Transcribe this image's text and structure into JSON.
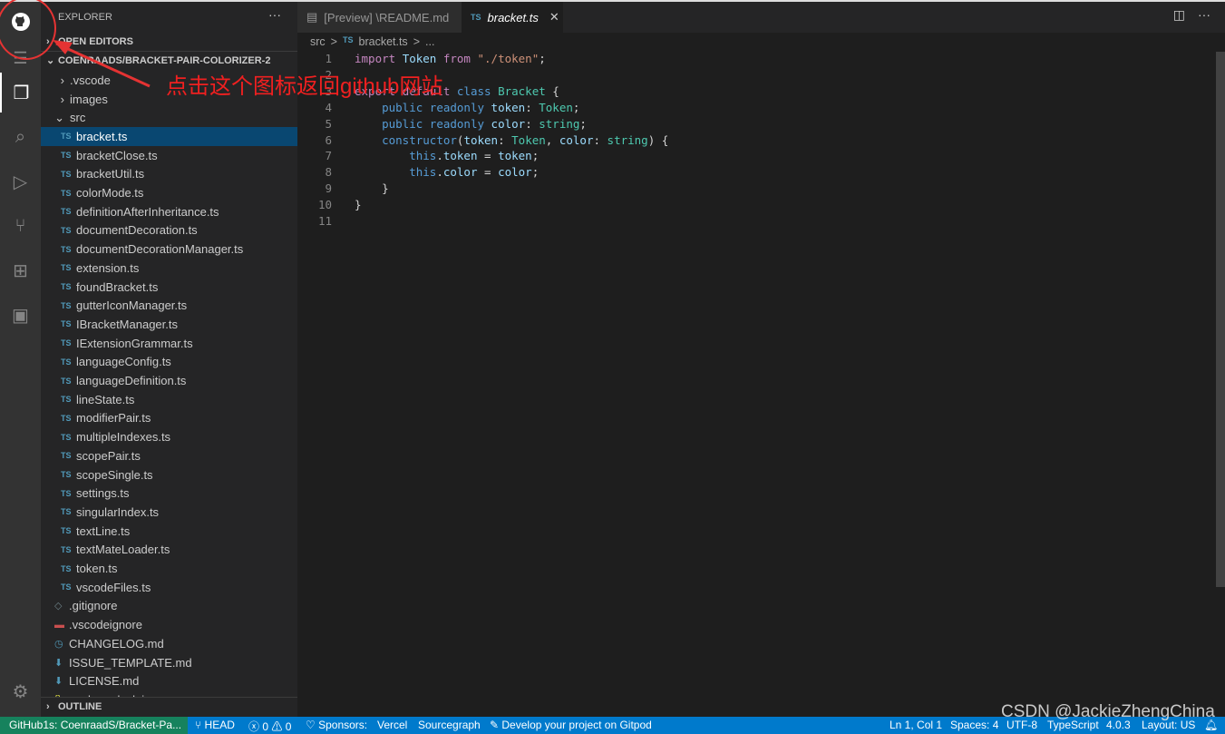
{
  "sidebar": {
    "title": "EXPLORER",
    "more": "···",
    "open_editors": "OPEN EDITORS",
    "root": "COENRAADS/BRACKET-PAIR-COLORIZER-2",
    "outline": "OUTLINE",
    "folders": [
      ".vscode",
      "images",
      "src"
    ],
    "src_files": [
      "bracket.ts",
      "bracketClose.ts",
      "bracketUtil.ts",
      "colorMode.ts",
      "definitionAfterInheritance.ts",
      "documentDecoration.ts",
      "documentDecorationManager.ts",
      "extension.ts",
      "foundBracket.ts",
      "gutterIconManager.ts",
      "IBracketManager.ts",
      "IExtensionGrammar.ts",
      "languageConfig.ts",
      "languageDefinition.ts",
      "lineState.ts",
      "modifierPair.ts",
      "multipleIndexes.ts",
      "scopePair.ts",
      "scopeSingle.ts",
      "settings.ts",
      "singularIndex.ts",
      "textLine.ts",
      "textMateLoader.ts",
      "token.ts",
      "vscodeFiles.ts"
    ],
    "root_files": [
      ".gitignore",
      ".vscodeignore",
      "CHANGELOG.md",
      "ISSUE_TEMPLATE.md",
      "LICENSE.md",
      "package-lock.json"
    ],
    "ts_badge": "TS"
  },
  "tabs": [
    {
      "label": "[Preview] \\README.md"
    },
    {
      "label": "bracket.ts",
      "close": "✕"
    }
  ],
  "breadcrumb": [
    "src",
    ">",
    "TS",
    "bracket.ts",
    ">",
    "..."
  ],
  "code": {
    "line_numbers": [
      "1",
      "2",
      "3",
      "4",
      "5",
      "6",
      "7",
      "8",
      "9",
      "10",
      "11"
    ]
  },
  "status": {
    "remote": "GitHub1s: CoenraadS/Bracket-Pa...",
    "branch": "HEAD",
    "errors": "0",
    "warnings": "0",
    "sponsors": "Sponsors:",
    "vercel": "Vercel",
    "sourcegraph": "Sourcegraph",
    "gitpod": "Develop your project on Gitpod",
    "position": "Ln 1, Col 1",
    "spaces": "Spaces: 4",
    "encoding": "UTF-8",
    "language": "TypeScript",
    "version": "4.0.3",
    "layout": "Layout: US"
  },
  "annotation": {
    "text": "点击这个图标返回github网站",
    "color": "#e53333"
  },
  "watermark": "CSDN @JackieZhengChina",
  "colors": {
    "status": "#007acc",
    "remote": "#16825d",
    "selection": "#094771"
  }
}
